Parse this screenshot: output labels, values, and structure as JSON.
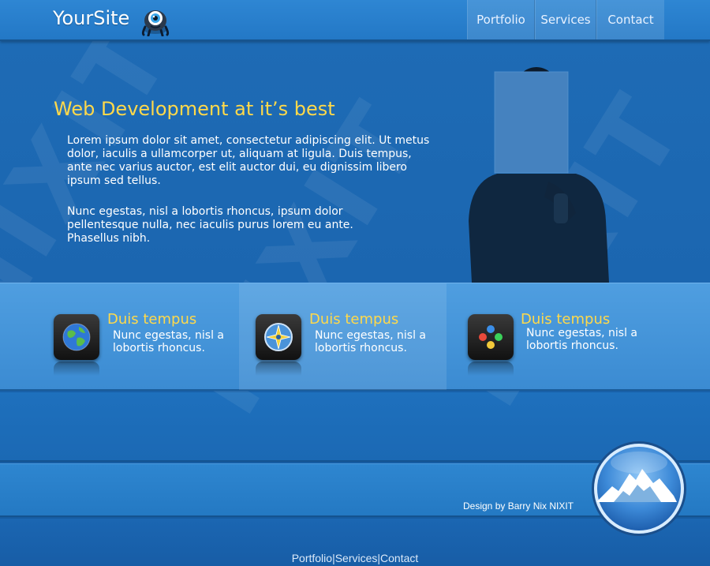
{
  "header": {
    "logo_text": "YourSite",
    "mascot_icon": "one-eyed-monster-icon",
    "nav": [
      {
        "label": "Portfolio"
      },
      {
        "label": "Services"
      },
      {
        "label": "Contact"
      }
    ]
  },
  "hero": {
    "title": "Web Development at it’s best",
    "paragraph1": "Lorem ipsum dolor sit amet, consectetur adipiscing elit. Ut metus dolor, iaculis a ullamcorper ut, aliquam at ligula. Duis tempus, ante nec varius auctor, est elit auctor dui, eu dignissim libero ipsum sed tellus.",
    "paragraph2": "Nunc egestas, nisl a lobortis rhoncus, ipsum dolor pellentesque nulla, nec iaculis purus lorem eu ante. Phasellus nibh."
  },
  "features": [
    {
      "title": "Duis tempus",
      "text": "Nunc egestas, nisl a lobortis rhoncus.",
      "icon": "globe-icon"
    },
    {
      "title": "Duis tempus",
      "text": "Nunc egestas, nisl a lobortis rhoncus.",
      "icon": "compass-icon"
    },
    {
      "title": "Duis tempus",
      "text": "Nunc egestas, nisl a lobortis rhoncus.",
      "icon": "colored-dots-icon"
    }
  ],
  "footer": {
    "credit": "Design by Barry Nix NIXIT",
    "badge_icon": "mountain-icon",
    "links": [
      "Portfolio",
      "Services",
      "Contact"
    ],
    "separator": "|"
  },
  "watermark": "NIXIT",
  "colors": {
    "accent_yellow": "#ffd94a",
    "brand_blue": "#1e6bb5"
  }
}
